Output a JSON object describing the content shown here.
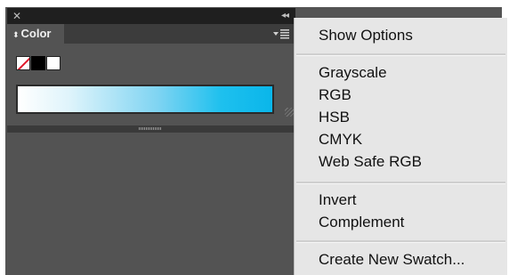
{
  "panel": {
    "close_glyph": "✕",
    "collapse_glyph": "◂◂",
    "tab_label": "Color",
    "tab_arrows": "⬍",
    "ramp_colors": [
      "#ffffff",
      "#0ab6ea"
    ],
    "swatches": [
      "none",
      "#000000",
      "#ffffff"
    ]
  },
  "menu": {
    "show_options": "Show Options",
    "grayscale": "Grayscale",
    "rgb": "RGB",
    "hsb": "HSB",
    "cmyk": "CMYK",
    "web_safe_rgb": "Web Safe RGB",
    "invert": "Invert",
    "complement": "Complement",
    "create_new_swatch": "Create New Swatch..."
  }
}
